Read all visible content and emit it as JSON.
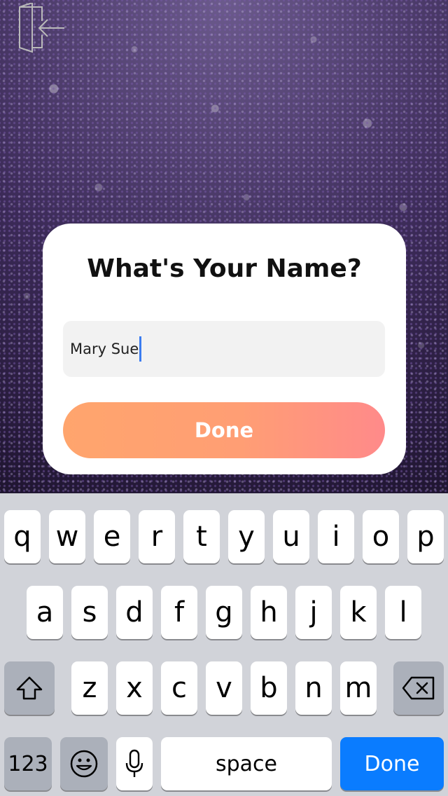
{
  "background": {
    "image": "purple-glitter"
  },
  "exit_button": {
    "icon": "exit-door-icon"
  },
  "dialog": {
    "title": "What's Your Name?",
    "name_input": {
      "value": "Mary Sue"
    },
    "done_label": "Done",
    "done_gradient": [
      "#ffa56d",
      "#ff8a8a"
    ]
  },
  "keyboard": {
    "row1": [
      "q",
      "w",
      "e",
      "r",
      "t",
      "y",
      "u",
      "i",
      "o",
      "p"
    ],
    "row2": [
      "a",
      "s",
      "d",
      "f",
      "g",
      "h",
      "j",
      "k",
      "l"
    ],
    "row3": [
      "z",
      "x",
      "c",
      "v",
      "b",
      "n",
      "m"
    ],
    "shift_icon": "shift-icon",
    "delete_icon": "delete-icon",
    "numbers_label": "123",
    "emoji_icon": "emoji-icon",
    "mic_icon": "microphone-icon",
    "space_label": "space",
    "done_label": "Done",
    "done_color": "#0a7cff"
  }
}
